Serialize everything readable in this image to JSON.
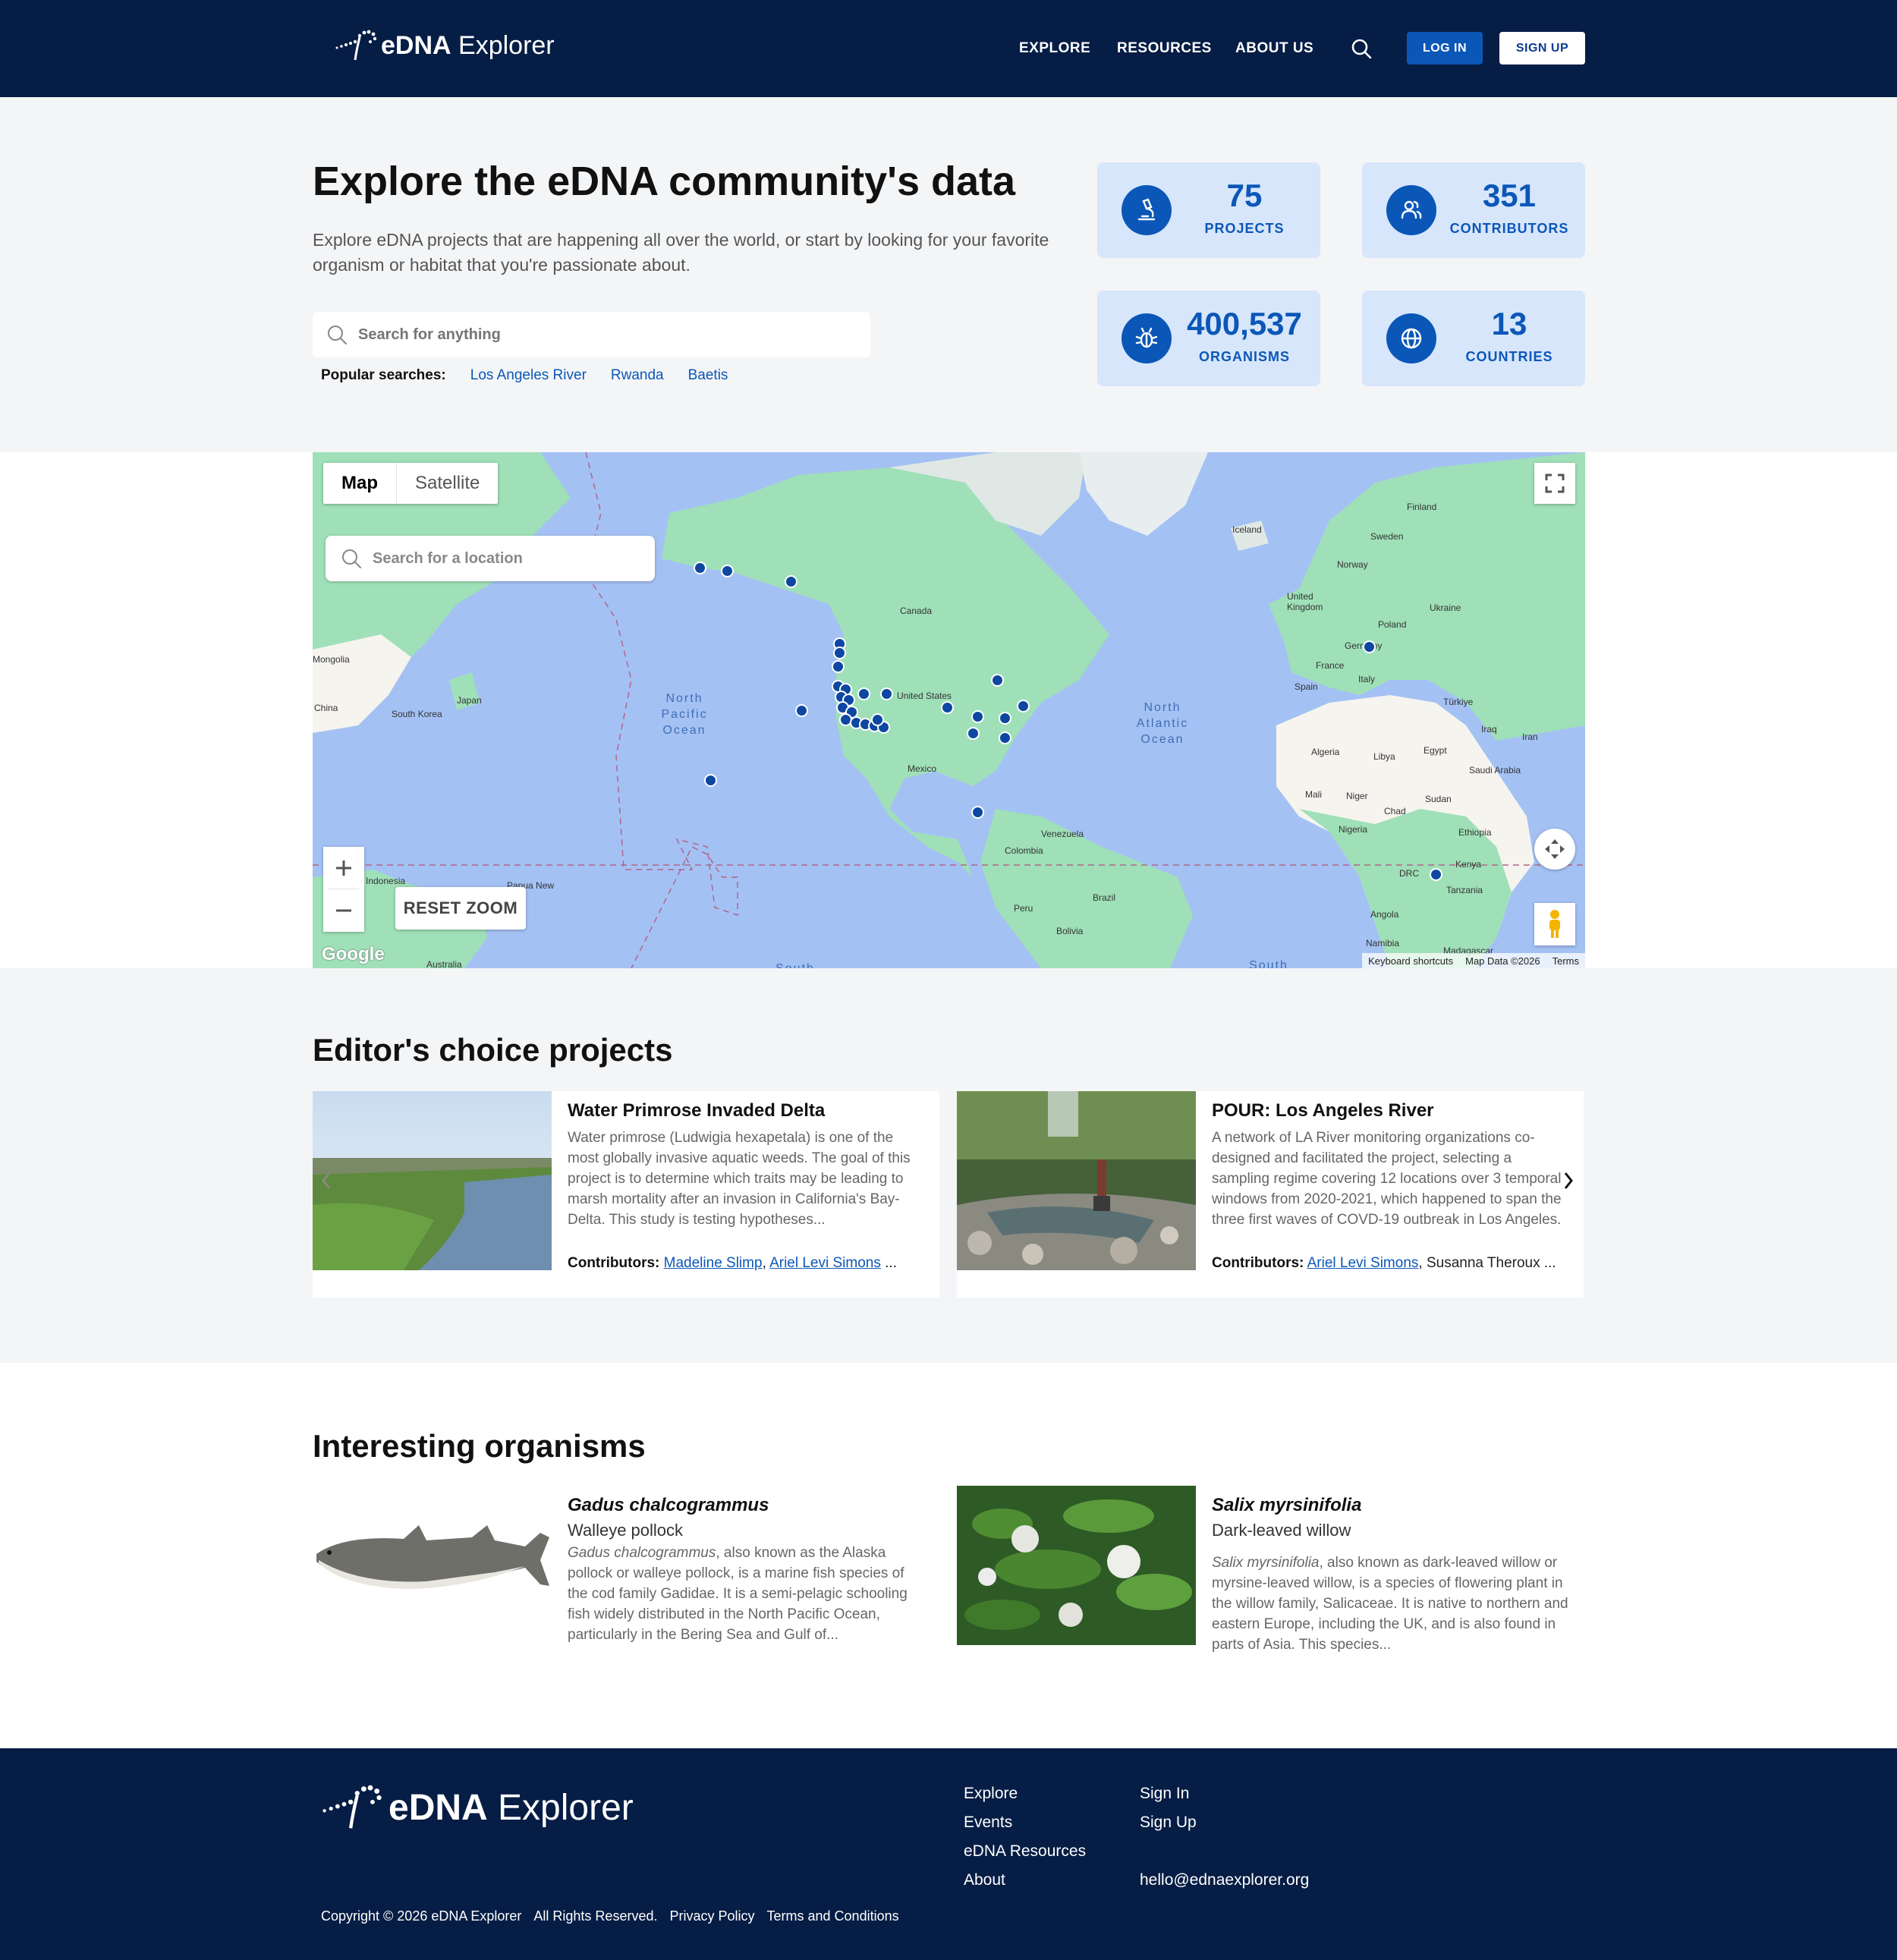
{
  "header": {
    "logo_bold": "eDNA",
    "logo_light": " Explorer",
    "nav": [
      "EXPLORE",
      "RESOURCES",
      "ABOUT US"
    ],
    "login": "LOG IN",
    "signup": "SIGN UP"
  },
  "hero": {
    "title": "Explore the eDNA community's data",
    "description": "Explore eDNA projects that are happening all over the world, or start by looking for your favorite organism or habitat that you're passionate about.",
    "search_placeholder": "Search for anything",
    "popular_label": "Popular searches:",
    "popular": [
      "Los Angeles River",
      "Rwanda",
      "Baetis"
    ]
  },
  "stats": [
    {
      "value": "75",
      "label": "PROJECTS",
      "icon": "microscope-icon"
    },
    {
      "value": "351",
      "label": "CONTRIBUTORS",
      "icon": "users-icon"
    },
    {
      "value": "400,537",
      "label": "ORGANISMS",
      "icon": "bug-icon"
    },
    {
      "value": "13",
      "label": "COUNTRIES",
      "icon": "globe-icon"
    }
  ],
  "map": {
    "type_map": "Map",
    "type_satellite": "Satellite",
    "location_placeholder": "Search for a location",
    "reset_zoom": "RESET ZOOM",
    "google": "Google",
    "attribution": [
      "Keyboard shortcuts",
      "Map Data ©2026",
      "Terms"
    ],
    "labels": [
      "Finland",
      "Sweden",
      "Iceland",
      "Norway",
      "United Kingdom",
      "Poland",
      "Ukraine",
      "Germany",
      "France",
      "Italy",
      "Spain",
      "Türkiye",
      "Iraq",
      "Iran",
      "Algeria",
      "Libya",
      "Egypt",
      "Saudi Arabia",
      "Mali",
      "Niger",
      "Chad",
      "Sudan",
      "Nigeria",
      "Ethiopia",
      "Kenya",
      "DRC",
      "Tanzania",
      "Angola",
      "Namibia",
      "Madagascar",
      "Canada",
      "United States",
      "Mexico",
      "Venezuela",
      "Colombia",
      "Peru",
      "Brazil",
      "Bolivia",
      "Mongolia",
      "China",
      "South Korea",
      "Japan",
      "Indonesia",
      "Papua New",
      "Australia"
    ],
    "oceans": [
      "North Pacific Ocean",
      "North Atlantic Ocean",
      "South",
      "South"
    ]
  },
  "editors_choice": {
    "title": "Editor's choice projects",
    "projects": [
      {
        "title": "Water Primrose Invaded Delta",
        "description": "Water primrose (Ludwigia hexapetala) is one of the most globally invasive aquatic weeds. The goal of this project is to determine which traits may be leading to marsh mortality after an invasion in California's Bay-Delta. This study is testing hypotheses...",
        "contributors_label": "Contributors:",
        "contributors": [
          "Madeline Slimp",
          "Ariel Levi Simons"
        ],
        "more": " ..."
      },
      {
        "title": "POUR: Los Angeles River",
        "description": "A network of LA River monitoring organizations co-designed and facilitated the project, selecting a sampling regime covering 12 locations over 3 temporal windows from 2020-2021, which happened to span the three first waves of COVD-19 outbreak in Los Angeles.",
        "contributors_label": "Contributors:",
        "contributors": [
          "Ariel Levi Simons"
        ],
        "extra": ", Susanna Theroux ..."
      }
    ]
  },
  "organisms": {
    "title": "Interesting organisms",
    "items": [
      {
        "scientific": "Gadus chalcogrammus",
        "common": "Walleye pollock",
        "desc_italic": "Gadus chalcogrammus",
        "description": ", also known as the Alaska pollock or walleye pollock, is a marine fish species of the cod family Gadidae. It is a semi-pelagic schooling fish widely distributed in the North Pacific Ocean, particularly in the Bering Sea and Gulf of..."
      },
      {
        "scientific": "Salix myrsinifolia",
        "common": "Dark-leaved willow",
        "desc_italic": "Salix myrsinifolia",
        "description": ", also known as dark-leaved willow or myrsine-leaved willow, is a species of flowering plant in the willow family, Salicaceae. It is native to northern and eastern Europe, including the UK, and is also found in parts of Asia. This species..."
      }
    ]
  },
  "footer": {
    "logo_bold": "eDNA",
    "logo_light": " Explorer",
    "col1": [
      "Explore",
      "Events",
      "eDNA Resources",
      "About"
    ],
    "col2": [
      "Sign In",
      "Sign Up"
    ],
    "email": "hello@ednaexplorer.org",
    "copyright": "Copyright © 2026 eDNA Explorer",
    "rights": "All Rights Reserved.",
    "privacy": "Privacy Policy",
    "terms": "Terms and Conditions"
  },
  "colors": {
    "navy": "#061d45",
    "primary": "#0b57b7",
    "stat_bg": "#d7e6fb",
    "ocean": "#a4c1f4",
    "land": "#9fe0b8"
  }
}
